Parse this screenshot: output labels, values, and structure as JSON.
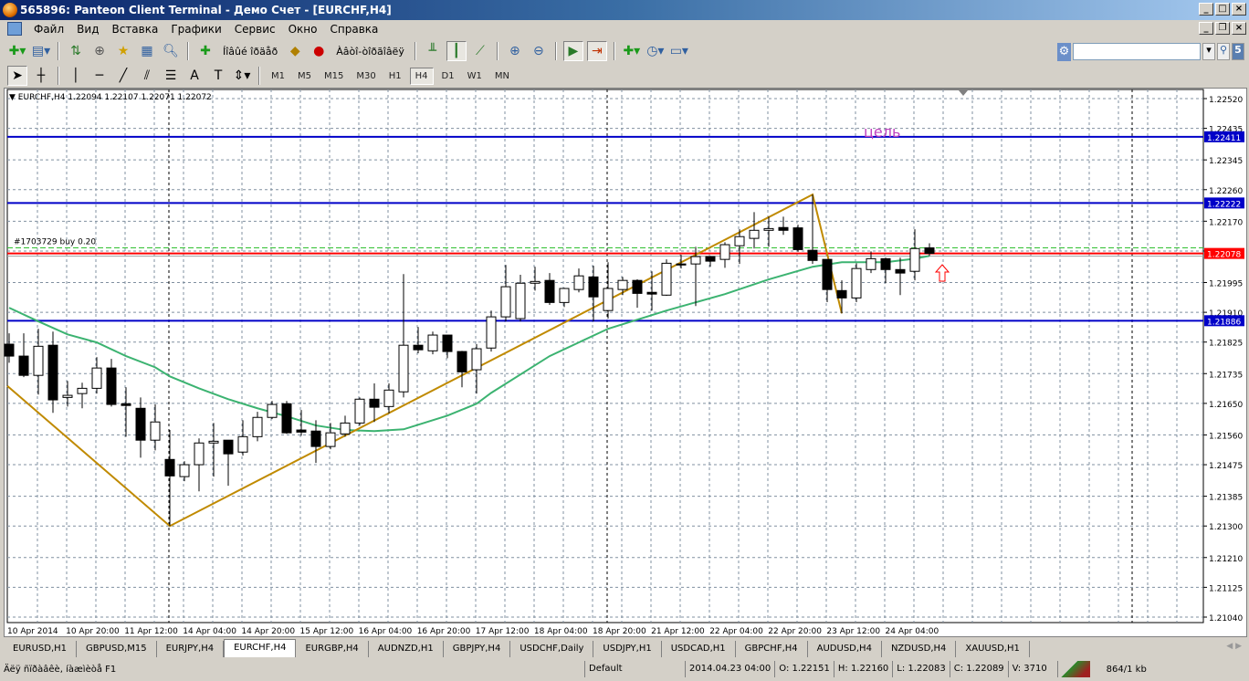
{
  "window": {
    "title": "565896: Panteon Client Terminal - Демо Счет - [EURCHF,H4]"
  },
  "menu": [
    "Файл",
    "Вид",
    "Вставка",
    "Графики",
    "Сервис",
    "Окно",
    "Справка"
  ],
  "toolbar": {
    "new_order_label": "Íîâûé îðäåð",
    "experts_label": "Àâòî-òîðãîâëÿ"
  },
  "timeframes": [
    "M1",
    "M5",
    "M15",
    "M30",
    "H1",
    "H4",
    "D1",
    "W1",
    "MN"
  ],
  "active_timeframe": "H4",
  "search": {
    "value": "",
    "badge": "5"
  },
  "chart": {
    "header": "EURCHF,H4  1.22094 1.22107 1.22071 1.22072",
    "order_label": "#1703729 buy 0.20",
    "annotation": "цель",
    "colors": {
      "bull": "#ffffff",
      "bear": "#000000",
      "ma": "#3cb371",
      "zigzag": "#c08a00",
      "hline": "#0000c8",
      "bid": "#ff0000",
      "annotation": "#c040c0"
    },
    "price_ticks": [
      "1.22520",
      "1.22435",
      "1.22345",
      "1.22260",
      "1.22170",
      "1.22085",
      "1.21995",
      "1.21910",
      "1.21825",
      "1.21735",
      "1.21650",
      "1.21560",
      "1.21475",
      "1.21385",
      "1.21300",
      "1.21210",
      "1.21125",
      "1.21040"
    ],
    "hlines": [
      "1.22411",
      "1.22222",
      "1.21886"
    ],
    "bid": "1.22078",
    "order_price": 1.22094,
    "time_labels": [
      "10 Apr 2014",
      "10 Apr 20:00",
      "11 Apr 12:00",
      "14 Apr 04:00",
      "14 Apr 20:00",
      "15 Apr 12:00",
      "16 Apr 04:00",
      "16 Apr 20:00",
      "17 Apr 12:00",
      "18 Apr 04:00",
      "18 Apr 20:00",
      "21 Apr 12:00",
      "22 Apr 04:00",
      "22 Apr 20:00",
      "23 Apr 12:00",
      "24 Apr 04:00"
    ]
  },
  "chart_data": {
    "type": "candlestick",
    "symbol": "EURCHF",
    "timeframe": "H4",
    "ylim": [
      1.2104,
      1.2252
    ],
    "grid": true,
    "ohlc": [
      [
        1.21819,
        1.2185,
        1.21766,
        1.21785
      ],
      [
        1.21785,
        1.2185,
        1.21725,
        1.2173
      ],
      [
        1.2173,
        1.21863,
        1.21675,
        1.21813
      ],
      [
        1.21816,
        1.21855,
        1.21623,
        1.2166
      ],
      [
        1.21667,
        1.21714,
        1.21641,
        1.21673
      ],
      [
        1.21678,
        1.21709,
        1.21636,
        1.21693
      ],
      [
        1.21693,
        1.21782,
        1.21678,
        1.21751
      ],
      [
        1.21751,
        1.21777,
        1.21641,
        1.21647
      ],
      [
        1.21649,
        1.21696,
        1.21555,
        1.21644
      ],
      [
        1.21636,
        1.21667,
        1.21495,
        1.21545
      ],
      [
        1.21545,
        1.21647,
        1.21516,
        1.21597
      ],
      [
        1.2149,
        1.21574,
        1.213,
        1.21443
      ],
      [
        1.21441,
        1.21485,
        1.21428,
        1.21475
      ],
      [
        1.21475,
        1.2155,
        1.21399,
        1.21537
      ],
      [
        1.21537,
        1.21594,
        1.21441,
        1.21542
      ],
      [
        1.21545,
        1.21545,
        1.21415,
        1.21506
      ],
      [
        1.21511,
        1.21602,
        1.21501,
        1.21555
      ],
      [
        1.21555,
        1.21626,
        1.21542,
        1.2161
      ],
      [
        1.2161,
        1.21657,
        1.21605,
        1.21647
      ],
      [
        1.21649,
        1.21657,
        1.21563,
        1.21566
      ],
      [
        1.21574,
        1.21631,
        1.21558,
        1.21568
      ],
      [
        1.21571,
        1.21602,
        1.2148,
        1.21527
      ],
      [
        1.21527,
        1.21594,
        1.21519,
        1.21566
      ],
      [
        1.21563,
        1.21615,
        1.21555,
        1.21594
      ],
      [
        1.21594,
        1.21667,
        1.21587,
        1.21662
      ],
      [
        1.21662,
        1.21707,
        1.21597,
        1.21639
      ],
      [
        1.21641,
        1.21707,
        1.21621,
        1.21688
      ],
      [
        1.21683,
        1.22019,
        1.21667,
        1.21816
      ],
      [
        1.21816,
        1.21868,
        1.21793,
        1.21803
      ],
      [
        1.218,
        1.21855,
        1.2179,
        1.21845
      ],
      [
        1.21845,
        1.21845,
        1.21779,
        1.21798
      ],
      [
        1.21798,
        1.218,
        1.21696,
        1.2174
      ],
      [
        1.21746,
        1.21819,
        1.21678,
        1.21806
      ],
      [
        1.21808,
        1.21915,
        1.21798,
        1.21897
      ],
      [
        1.21897,
        1.22045,
        1.21884,
        1.21983
      ],
      [
        1.21892,
        1.22017,
        1.21884,
        1.21993
      ],
      [
        1.21993,
        1.2204,
        1.21972,
        1.21998
      ],
      [
        1.22001,
        1.22022,
        1.21931,
        1.21938
      ],
      [
        1.21938,
        1.2198,
        1.21925,
        1.21978
      ],
      [
        1.21975,
        1.22035,
        1.21967,
        1.22014
      ],
      [
        1.22011,
        1.22043,
        1.21884,
        1.21954
      ],
      [
        1.21915,
        1.22053,
        1.21892,
        1.21978
      ],
      [
        1.21975,
        1.22011,
        1.21959,
        1.22001
      ],
      [
        1.22001,
        1.22004,
        1.21923,
        1.21964
      ],
      [
        1.21967,
        1.22027,
        1.21915,
        1.21962
      ],
      [
        1.21959,
        1.22061,
        1.21957,
        1.2205
      ],
      [
        1.22048,
        1.22074,
        1.22035,
        1.22045
      ],
      [
        1.22048,
        1.22097,
        1.21928,
        1.22069
      ],
      [
        1.22069,
        1.22071,
        1.2204,
        1.22056
      ],
      [
        1.22061,
        1.2211,
        1.22037,
        1.22103
      ],
      [
        1.221,
        1.22147,
        1.22048,
        1.22126
      ],
      [
        1.22121,
        1.22196,
        1.22092,
        1.22144
      ],
      [
        1.22144,
        1.22183,
        1.22097,
        1.22149
      ],
      [
        1.22152,
        1.22183,
        1.22131,
        1.22144
      ],
      [
        1.22151,
        1.2216,
        1.22083,
        1.22089
      ],
      [
        1.22087,
        1.22246,
        1.22048,
        1.22058
      ],
      [
        1.22061,
        1.22061,
        1.21939,
        1.21975
      ],
      [
        1.21972,
        1.22001,
        1.21907,
        1.21951
      ],
      [
        1.21951,
        1.2205,
        1.21939,
        1.22035
      ],
      [
        1.22032,
        1.22084,
        1.22022,
        1.22063
      ],
      [
        1.22063,
        1.22066,
        1.21993,
        1.22032
      ],
      [
        1.22032,
        1.22066,
        1.21959,
        1.22022
      ],
      [
        1.22027,
        1.22147,
        1.22001,
        1.22092
      ],
      [
        1.22094,
        1.22107,
        1.22071,
        1.22078
      ]
    ],
    "moving_average": [
      [
        0,
        1.21923
      ],
      [
        2,
        1.21884
      ],
      [
        4,
        1.21847
      ],
      [
        6,
        1.21824
      ],
      [
        8,
        1.21785
      ],
      [
        10,
        1.21753
      ],
      [
        11,
        1.21727
      ],
      [
        13,
        1.21693
      ],
      [
        15,
        1.21662
      ],
      [
        17,
        1.21636
      ],
      [
        19,
        1.21613
      ],
      [
        21,
        1.21587
      ],
      [
        23,
        1.21574
      ],
      [
        25,
        1.21571
      ],
      [
        27,
        1.21576
      ],
      [
        28,
        1.21589
      ],
      [
        30,
        1.21615
      ],
      [
        32,
        1.21649
      ],
      [
        33,
        1.2168
      ],
      [
        37,
        1.21785
      ],
      [
        41,
        1.21863
      ],
      [
        45,
        1.21915
      ],
      [
        49,
        1.21962
      ],
      [
        52,
        1.22004
      ],
      [
        55,
        1.2204
      ],
      [
        57,
        1.22053
      ],
      [
        60,
        1.22053
      ],
      [
        62,
        1.22063
      ],
      [
        63,
        1.22071
      ]
    ],
    "zigzag": [
      [
        0,
        1.217
      ],
      [
        11,
        1.213
      ],
      [
        55,
        1.22246
      ],
      [
        57,
        1.21907
      ]
    ]
  },
  "tabs": [
    "EURUSD,H1",
    "GBPUSD,M15",
    "EURJPY,H4",
    "EURCHF,H4",
    "EURGBP,H4",
    "AUDNZD,H1",
    "GBPJPY,H4",
    "USDCHF,Daily",
    "USDJPY,H1",
    "USDCAD,H1",
    "GBPCHF,H4",
    "AUDUSD,H4",
    "NZDUSD,H4",
    "XAUUSD,H1"
  ],
  "active_tab": "EURCHF,H4",
  "status": {
    "help": "Äëÿ ñïðàâêè, íàæìèòå F1",
    "profile": "Default",
    "datetime": "2014.04.23 04:00",
    "open": "O: 1.22151",
    "high": "H: 1.22160",
    "low": "L: 1.22083",
    "close": "C: 1.22089",
    "volume": "V: 3710",
    "traffic": "864/1 kb"
  }
}
